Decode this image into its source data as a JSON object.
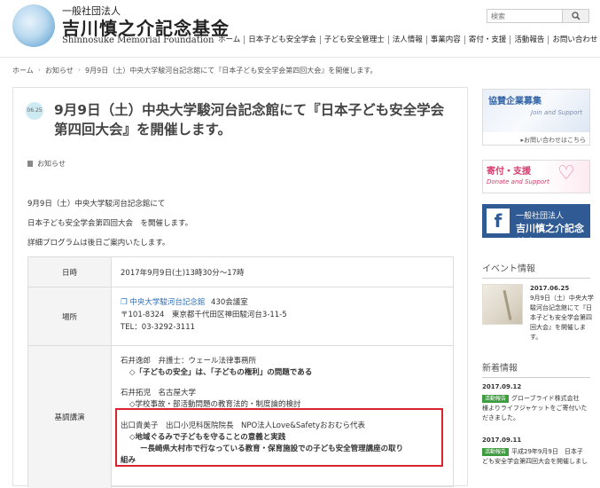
{
  "header": {
    "org_small": "一般社団法人",
    "org_main": "吉川慎之介記念基金",
    "org_en": "Shinnosuke Memorial Foundation",
    "search_placeholder": "検索",
    "nav": [
      "ホーム",
      "日本子ども安全学会",
      "子ども安全管理士",
      "法人情報",
      "事業内容",
      "寄付・支援",
      "活動報告",
      "お問い合わせ"
    ]
  },
  "breadcrumb": [
    "ホーム",
    "お知らせ",
    "9月9日（土）中央大学駿河台記念館にて『日本子ども安全学会第四回大会』を開催します。"
  ],
  "post": {
    "date_badge": "06.25",
    "title_line1": "9月9日（土）中央大学駿河台記念館にて『日本子ども安全学会",
    "title_line2": "第四回大会』を開催します。",
    "category": "お知らせ",
    "body": [
      "9月9日（土）中央大学駿河台記念館にて",
      "日本子ども安全学会第四回大会　を開催します。",
      "詳細プログラムは後日ご案内いたします。"
    ],
    "table": {
      "date_label": "日時",
      "date_value": "2017年9月9日(土)13時30分〜17時",
      "place_label": "場所",
      "place_name": "中央大学駿河台記念館",
      "place_room": "430会議室",
      "place_addr": "〒101-8324　東京都千代田区神田駿河台3-11-5",
      "place_tel": "TEL：03-3292-3111",
      "lecture_label": "基調講演",
      "speaker1": "石井逸郎　弁護士：ウェール法律事務所",
      "talk1": "◇「子どもの安全」は、「子どもの権利」の問題である",
      "speaker2": "石井拓児　名古屋大学",
      "talk2": "◇学校事故・部活動問題の教育法的・制度論的検討",
      "speaker3": "出口貴美子　出口小児科医院院長　NPO法人Love&Safetyおおむら代表",
      "talk3a": "◇地域ぐるみで子どもを守ることの意義と実践",
      "talk3b": "ー長崎県大村市で行なっている教育・保育施設での子ども安全管理講座の取り",
      "talk3c": "組み"
    }
  },
  "sidebar": {
    "kyosan_title": "協賛企業募集",
    "kyosan_sub": "Join and Support",
    "kyosan_link": "▸お問い合わせはこちら",
    "kifu_title": "寄付・支援",
    "kifu_sub": "Donate and Support",
    "fb_line1": "一般社団法人",
    "fb_line2": "吉川慎之介記念基金",
    "event_heading": "イベント情報",
    "event_date": "2017.06.25",
    "event_text": "9月9日（土）中央大学駿河台記念館にて『日本子ども安全学会第四回大会』を開催します。",
    "news_heading": "新着情報",
    "news": [
      {
        "date": "2017.09.12",
        "badge": "活動報告",
        "line1": "グローブライド株式会社",
        "line2": "様よりライフジャケットをご寄付いた",
        "line3": "だきました。"
      },
      {
        "date": "2017.09.11",
        "badge": "活動報告",
        "line1": "平成29年9月9日　日本子",
        "line2": "ども安全学会第四回大会を開催しまし",
        "line3": ""
      }
    ]
  }
}
